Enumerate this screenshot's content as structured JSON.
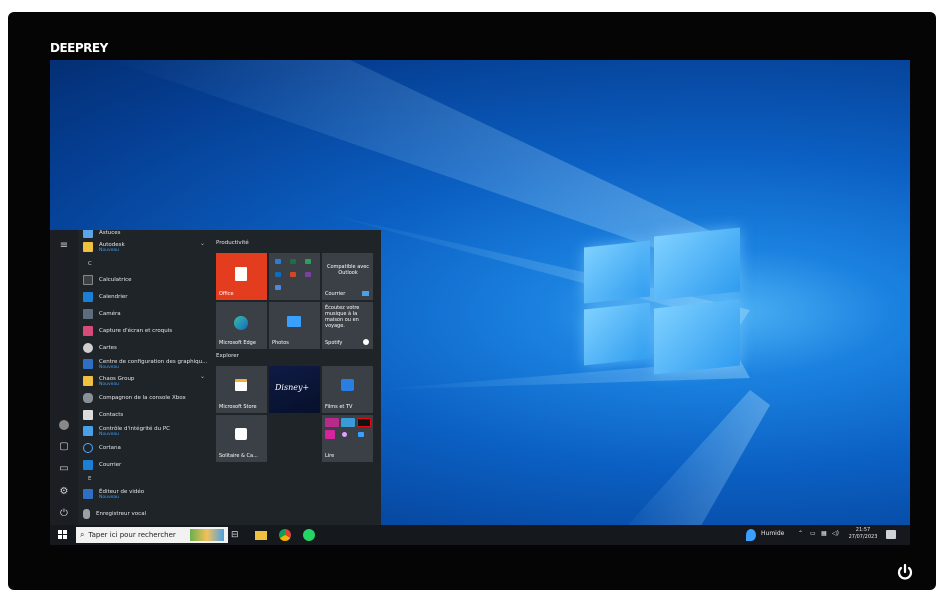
{
  "monitor": {
    "brand": "DEEPREY"
  },
  "start_menu": {
    "top_partial": "Astuces",
    "apps": [
      {
        "label": "Autodesk",
        "sub": "Nouveau"
      },
      {
        "label": "Calculatrice"
      },
      {
        "label": "Calendrier"
      },
      {
        "label": "Caméra"
      },
      {
        "label": "Capture d'écran et croquis"
      },
      {
        "label": "Cartes"
      },
      {
        "label": "Centre de configuration des graphiqu...",
        "sub": "Nouveau"
      },
      {
        "label": "Chaos Group",
        "sub": "Nouveau"
      },
      {
        "label": "Compagnon de la console Xbox"
      },
      {
        "label": "Contacts"
      },
      {
        "label": "Contrôle d'intégrité du PC",
        "sub": "Nouveau"
      },
      {
        "label": "Cortana"
      },
      {
        "label": "Courrier"
      },
      {
        "label": "Éditeur de vidéo",
        "sub": "Nouveau"
      },
      {
        "label": "Enregistreur vocal"
      }
    ],
    "letters": {
      "c": "C",
      "e": "E"
    },
    "groups": {
      "productivity": "Productivité",
      "explore": "Explorer"
    },
    "tiles": {
      "office": "Office",
      "outlook_text": "Compatible avec Outlook",
      "mail": "Courrier",
      "edge": "Microsoft Edge",
      "photos": "Photos",
      "spotify_text": "Écoutez votre musique à la maison ou en voyage.",
      "spotify": "Spotify",
      "store": "Microsoft Store",
      "disney": "Disney+",
      "films": "Films et TV",
      "solitaire": "Solitaire & Ca...",
      "lire": "Lire"
    }
  },
  "taskbar": {
    "search_placeholder": "Taper ici pour rechercher",
    "weather": "Humide",
    "time": "21:57",
    "date": "27/07/2023"
  },
  "colors": {
    "accent": "#0078d7",
    "office_red": "#e43c1e",
    "taskbar": "#15191d"
  }
}
